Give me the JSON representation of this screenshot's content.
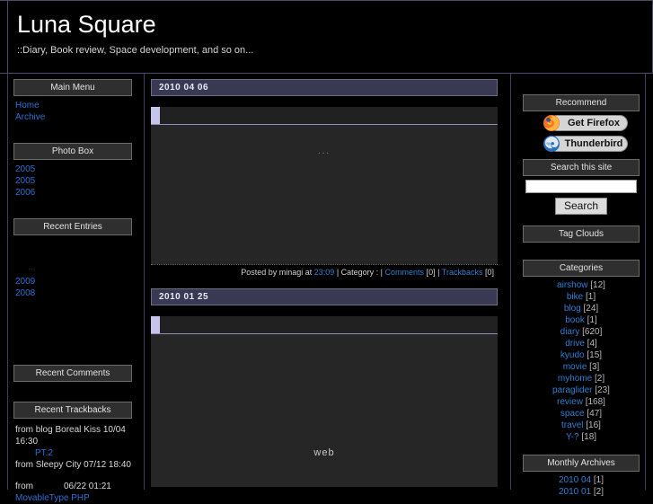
{
  "site": {
    "title": "Luna Square",
    "description": "::Diary, Book review, Space development, and so on..."
  },
  "topbar": {
    "empty_box_label": ""
  },
  "left_sidebar": {
    "main_menu": {
      "heading": "Main Menu",
      "items": [
        {
          "label": "Home"
        },
        {
          "label": "Archive"
        }
      ]
    },
    "photo_box": {
      "heading": "Photo Box",
      "items": [
        {
          "label": "2005"
        },
        {
          "label": "2005"
        },
        {
          "label": "2006"
        }
      ]
    },
    "recent_entries": {
      "heading": "Recent Entries",
      "ellipsis": "...",
      "items": [
        {
          "label": "2009"
        },
        {
          "label": "2008"
        }
      ]
    },
    "recent_comments": {
      "heading": "Recent Comments"
    },
    "recent_trackbacks": {
      "heading": "Recent Trackbacks",
      "entries": [
        {
          "line1": "from blog Boreal Kiss 10/04",
          "line2": "16:30",
          "link": "PT.2"
        },
        {
          "line1": "from Sleepy City 07/12 18:40",
          "line2": "",
          "link": ""
        },
        {
          "from_label": "from",
          "date": "06/22 01:21",
          "link": "MovableType PHP"
        }
      ]
    }
  },
  "main": {
    "entries": [
      {
        "date_bar": "2010 04 06",
        "title": "",
        "body_text": "...",
        "footer": {
          "posted_by": "Posted by minagi at",
          "time": "23:09",
          "sep1": "| Category : |",
          "comments_label": "Comments",
          "comments_count": "[0]",
          "sep2": "|",
          "trackbacks_label": "Trackbacks",
          "trackbacks_count": "[0]"
        }
      },
      {
        "date_bar": "2010 01 25",
        "title": "",
        "body_text": "web",
        "footer": null
      }
    ]
  },
  "right_sidebar": {
    "recommend": {
      "heading": "Recommend",
      "badges": [
        {
          "label": "Get Firefox",
          "icon": "firefox-icon"
        },
        {
          "label": "Thunderbird",
          "icon": "thunderbird-icon"
        }
      ]
    },
    "search": {
      "heading": "Search this site",
      "value": "",
      "placeholder": "",
      "button_label": "Search"
    },
    "tag_clouds": {
      "heading": "Tag Clouds"
    },
    "categories": {
      "heading": "Categories",
      "items": [
        {
          "label": "airshow",
          "count": "[12]"
        },
        {
          "label": "bike",
          "count": "[1]"
        },
        {
          "label": "blog",
          "count": "[24]"
        },
        {
          "label": "book",
          "count": "[1]"
        },
        {
          "label": "diary",
          "count": "[620]"
        },
        {
          "label": "drive",
          "count": "[4]"
        },
        {
          "label": "kyudo",
          "count": "[15]"
        },
        {
          "label": "movie",
          "count": "[3]"
        },
        {
          "label": "myhome",
          "count": "[2]"
        },
        {
          "label": "paraglider",
          "count": "[23]"
        },
        {
          "label": "review",
          "count": "[168]"
        },
        {
          "label": "space",
          "count": "[47]"
        },
        {
          "label": "travel",
          "count": "[16]"
        },
        {
          "label": "Y-?",
          "count": "[18]"
        }
      ]
    },
    "monthly_archives": {
      "heading": "Monthly Archives",
      "items": [
        {
          "label": "2010 04",
          "count": "[1]"
        },
        {
          "label": "2010 01",
          "count": "[2]"
        }
      ]
    }
  },
  "colors": {
    "background": "#000000",
    "accent_blue": "#2f7fd0",
    "date_bar": "#393954",
    "entry_accent": "#c5c5ec",
    "divider": "#3f3f5c"
  }
}
